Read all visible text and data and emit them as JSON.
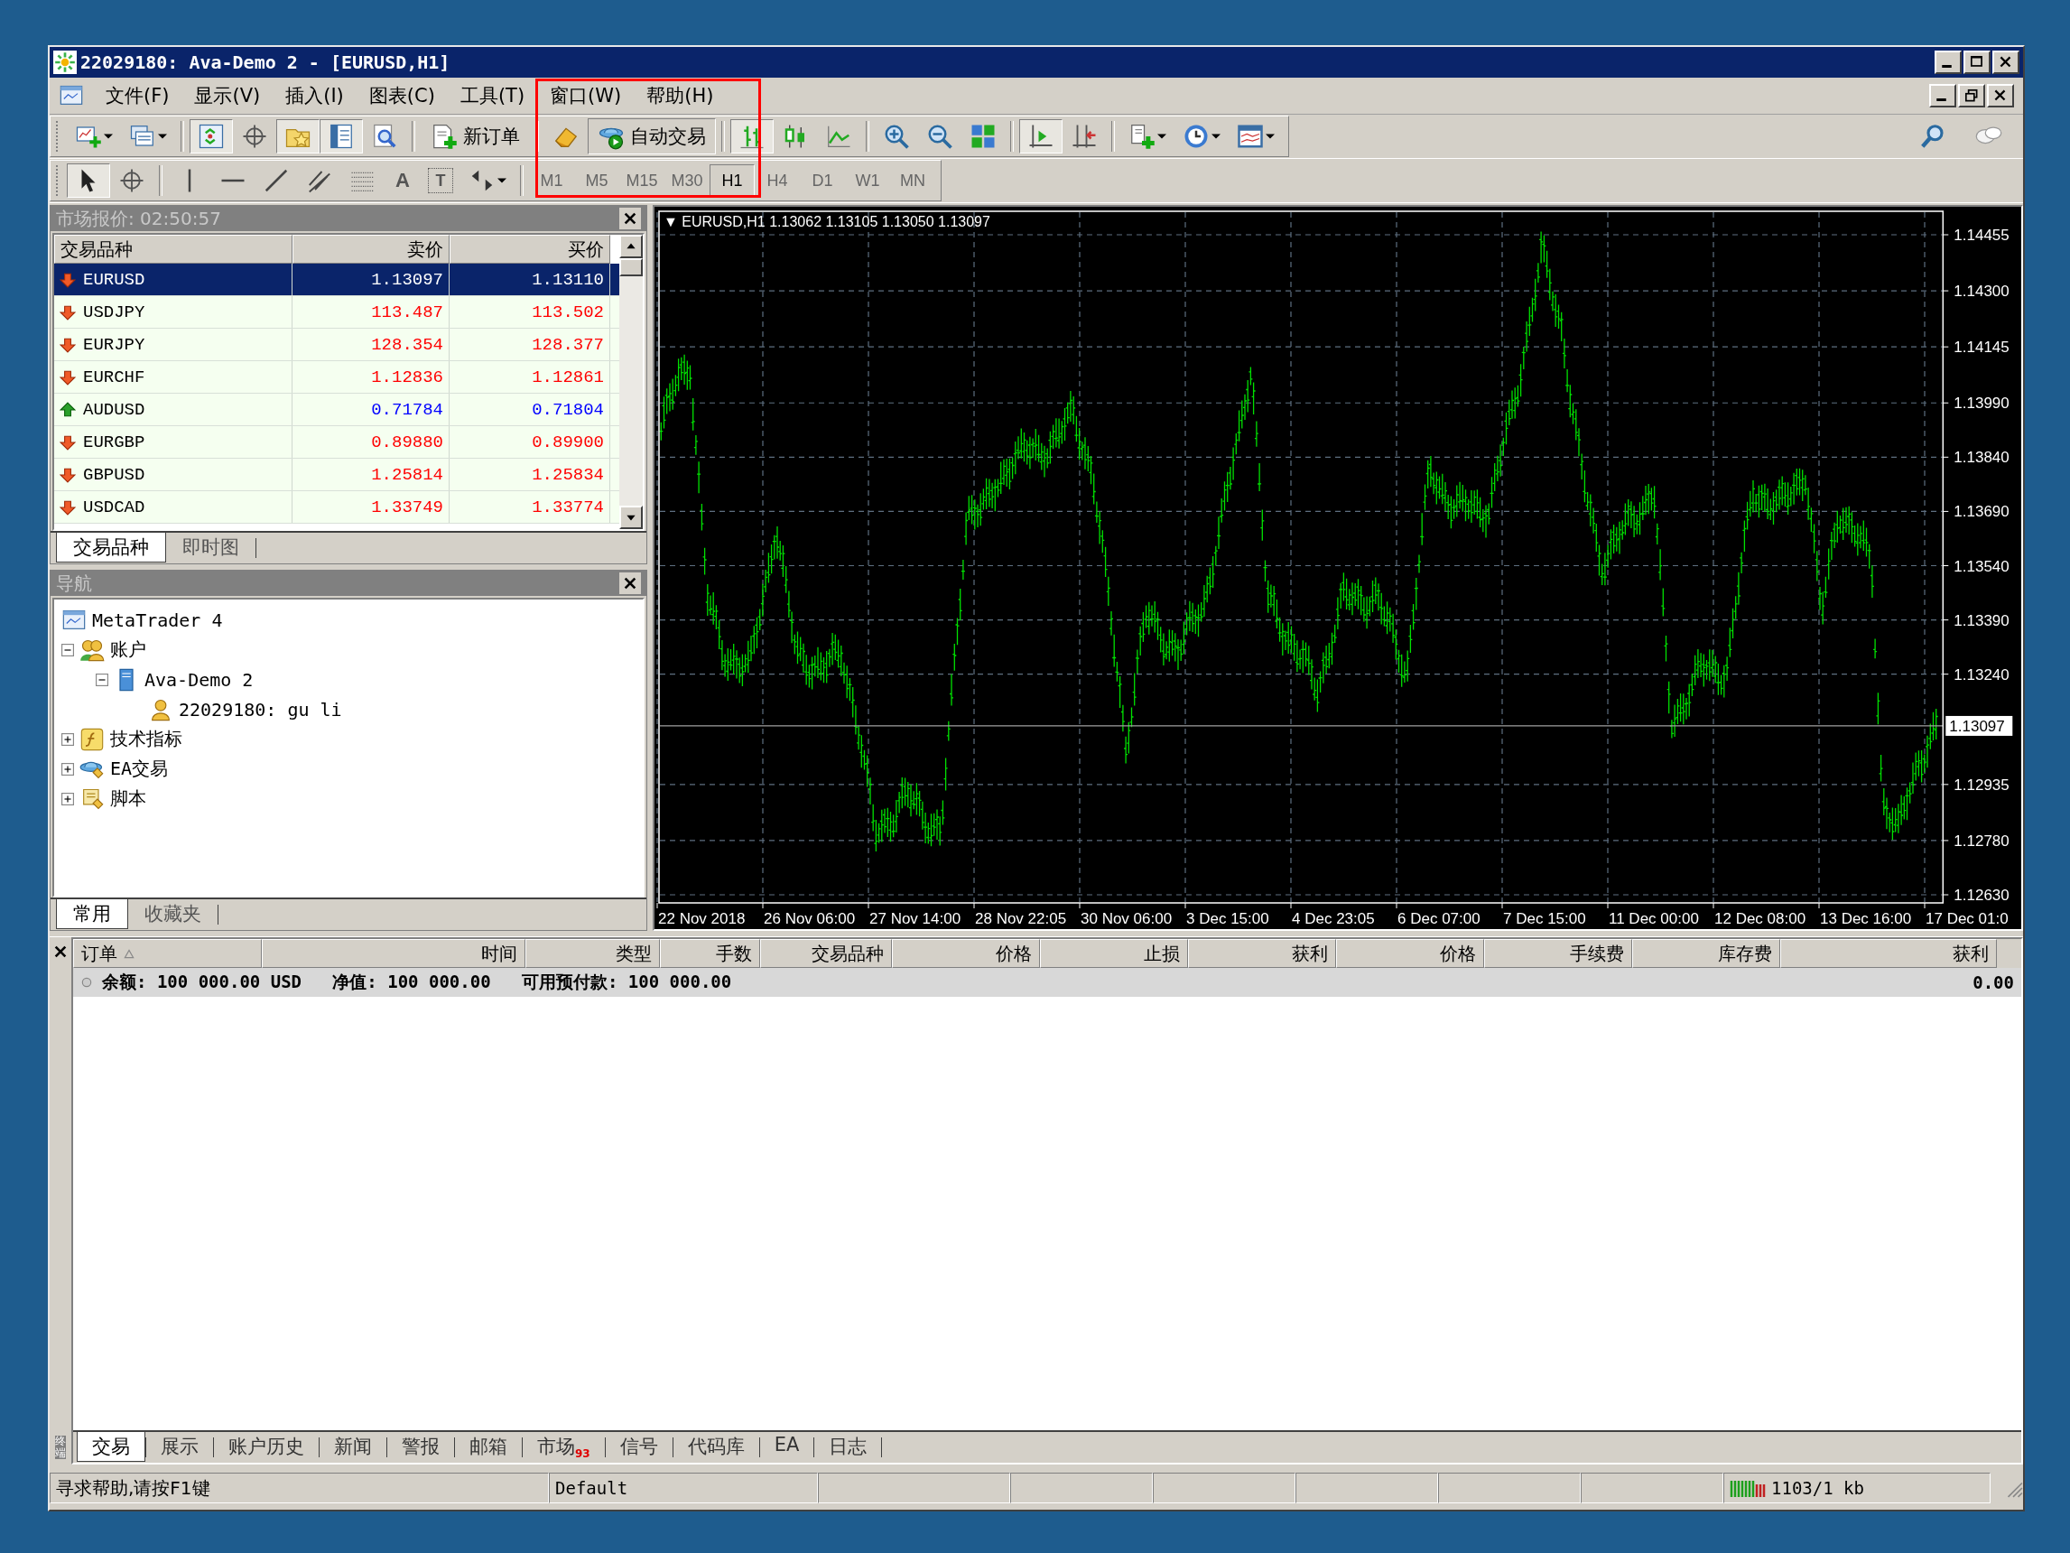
{
  "window": {
    "title": "22029180: Ava-Demo 2 - [EURUSD,H1]"
  },
  "menu": [
    {
      "label": "文件(F)"
    },
    {
      "label": "显示(V)"
    },
    {
      "label": "插入(I)"
    },
    {
      "label": "图表(C)"
    },
    {
      "label": "工具(T)"
    },
    {
      "label": "窗口(W)"
    },
    {
      "label": "帮助(H)"
    }
  ],
  "toolbar": {
    "new_order": "新订单",
    "autotrading": {
      "label": "自动交易",
      "selected": true
    }
  },
  "drawing_tools": {
    "text_tool": "A",
    "label_tool": "T"
  },
  "timeframes": [
    {
      "label": "M1",
      "selected": false
    },
    {
      "label": "M5",
      "selected": false
    },
    {
      "label": "M15",
      "selected": false
    },
    {
      "label": "M30",
      "selected": false
    },
    {
      "label": "H1",
      "selected": true
    },
    {
      "label": "H4",
      "selected": false
    },
    {
      "label": "D1",
      "selected": false
    },
    {
      "label": "W1",
      "selected": false
    },
    {
      "label": "MN",
      "selected": false
    }
  ],
  "market_watch": {
    "title": "市场报价: 02:50:57",
    "columns": [
      "交易品种",
      "卖价",
      "买价"
    ],
    "rows": [
      {
        "symbol": "EURUSD",
        "bid": "1.13097",
        "ask": "1.13110",
        "rising": false,
        "selected": true
      },
      {
        "symbol": "USDJPY",
        "bid": "113.487",
        "ask": "113.502",
        "rising": false,
        "selected": false
      },
      {
        "symbol": "EURJPY",
        "bid": "128.354",
        "ask": "128.377",
        "rising": false,
        "selected": false
      },
      {
        "symbol": "EURCHF",
        "bid": "1.12836",
        "ask": "1.12861",
        "rising": false,
        "selected": false
      },
      {
        "symbol": "AUDUSD",
        "bid": "0.71784",
        "ask": "0.71804",
        "rising": true,
        "selected": false
      },
      {
        "symbol": "EURGBP",
        "bid": "0.89880",
        "ask": "0.89900",
        "rising": false,
        "selected": false
      },
      {
        "symbol": "GBPUSD",
        "bid": "1.25814",
        "ask": "1.25834",
        "rising": false,
        "selected": false
      },
      {
        "symbol": "USDCAD",
        "bid": "1.33749",
        "ask": "1.33774",
        "rising": false,
        "selected": false
      }
    ],
    "tabs": [
      {
        "label": "交易品种",
        "selected": true
      },
      {
        "label": "即时图",
        "selected": false
      }
    ]
  },
  "navigator": {
    "title": "导航",
    "tree": [
      {
        "label": "MetaTrader 4",
        "kind": "terminal",
        "children": [
          {
            "label": "账户",
            "kind": "accounts",
            "expanded": true,
            "children": [
              {
                "label": "Ava-Demo 2",
                "kind": "server",
                "expanded": true,
                "children": [
                  {
                    "label": "22029180: gu li",
                    "kind": "user"
                  }
                ]
              }
            ]
          },
          {
            "label": "技术指标",
            "kind": "indicators",
            "expanded": false
          },
          {
            "label": "EA交易",
            "kind": "experts",
            "expanded": false
          },
          {
            "label": "脚本",
            "kind": "scripts",
            "expanded": false
          }
        ]
      }
    ],
    "tabs": [
      {
        "label": "常用",
        "selected": true
      },
      {
        "label": "收藏夹",
        "selected": false
      }
    ]
  },
  "chart": {
    "header": "▼ EURUSD,H1  1.13062 1.13105 1.13050 1.13097",
    "current_price": "1.13097",
    "y_labels": [
      "1.14455",
      "1.14300",
      "1.14145",
      "1.13990",
      "1.13840",
      "1.13690",
      "1.13540",
      "1.13390",
      "1.13240",
      "1.12935",
      "1.12780",
      "1.12630"
    ],
    "x_labels": [
      "22 Nov 2018",
      "26 Nov 06:00",
      "27 Nov 14:00",
      "28 Nov 22:05",
      "30 Nov 06:00",
      "3 Dec 15:00",
      "4 Dec 23:05",
      "6 Dec 07:00",
      "7 Dec 15:00",
      "11 Dec 00:00",
      "12 Dec 08:00",
      "13 Dec 16:00",
      "17 Dec 01:0"
    ]
  },
  "terminal": {
    "side_label": "终端",
    "columns": [
      "订单",
      "时间",
      "类型",
      "手数",
      "交易品种",
      "价格",
      "止损",
      "获利",
      "价格",
      "手续费",
      "库存费",
      "获利"
    ],
    "balance": "余额: 100 000.00 USD   净值: 100 000.00   可用预付款: 100 000.00",
    "profit": "0.00",
    "tabs": [
      {
        "label": "交易",
        "selected": true
      },
      {
        "label": "展示",
        "selected": false
      },
      {
        "label": "账户历史",
        "selected": false
      },
      {
        "label": "新闻",
        "selected": false
      },
      {
        "label": "警报",
        "selected": false
      },
      {
        "label": "邮箱",
        "selected": false
      },
      {
        "label": "市场",
        "badge": "93",
        "selected": false
      },
      {
        "label": "信号",
        "selected": false
      },
      {
        "label": "代码库",
        "selected": false
      },
      {
        "label": "EA",
        "selected": false
      },
      {
        "label": "日志",
        "selected": false
      }
    ]
  },
  "status_bar": {
    "help": "寻求帮助,请按F1键",
    "profile": "Default",
    "traffic": "1103/1 kb"
  }
}
